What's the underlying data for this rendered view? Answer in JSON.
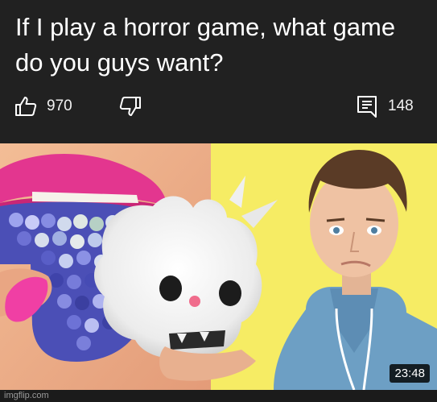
{
  "post": {
    "text": "If I play a horror game, what game do you guys want?",
    "likes": "970",
    "comments": "148"
  },
  "icons": {
    "like": "thumbs-up-icon",
    "dislike": "thumbs-down-icon",
    "comments": "comment-icon"
  },
  "video": {
    "duration": "23:48"
  },
  "watermark": "imgflip.com",
  "colors": {
    "background": "#212121",
    "text": "#ffffff",
    "thumbnail_backdrop": "#f6ec64"
  }
}
